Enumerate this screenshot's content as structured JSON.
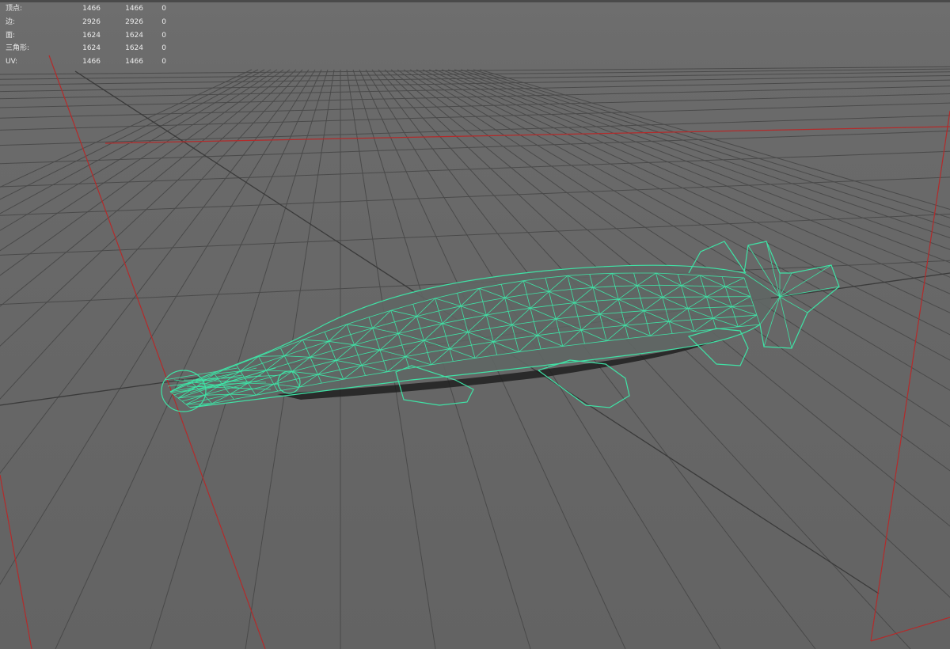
{
  "viewport": {
    "background": "#6b6b6b",
    "grid_color": "#474747",
    "axis_color": "#b32b2b",
    "wireframe_color": "#3fe3a6"
  },
  "hud": {
    "rows": [
      {
        "label": "顶点:",
        "total": "1466",
        "selected": "1466",
        "extra": "0"
      },
      {
        "label": "边:",
        "total": "2926",
        "selected": "2926",
        "extra": "0"
      },
      {
        "label": "面:",
        "total": "1624",
        "selected": "1624",
        "extra": "0"
      },
      {
        "label": "三角形:",
        "total": "1624",
        "selected": "1624",
        "extra": "0"
      },
      {
        "label": "UV:",
        "total": "1466",
        "selected": "1466",
        "extra": "0"
      }
    ]
  },
  "model": {
    "name": "fish-wireframe"
  }
}
